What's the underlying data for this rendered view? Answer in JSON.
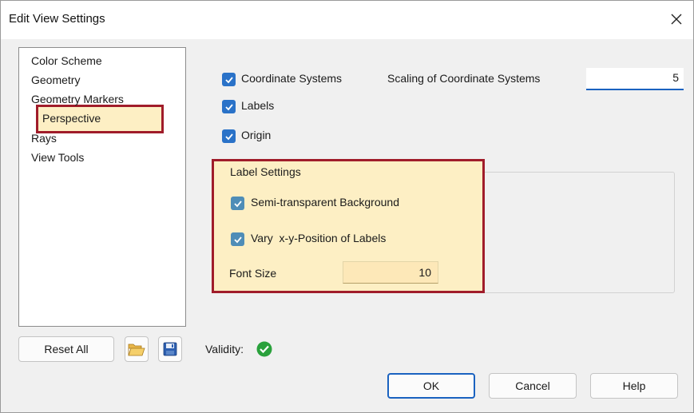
{
  "window": {
    "title": "Edit View Settings",
    "close_icon": "close-icon"
  },
  "nav": {
    "items": [
      {
        "label": "Color Scheme"
      },
      {
        "label": "Geometry"
      },
      {
        "label": "Geometry Markers"
      },
      {
        "label": "Perspective",
        "selected": true
      },
      {
        "label": "Rays"
      },
      {
        "label": "View Tools"
      }
    ]
  },
  "options": {
    "coordinate_systems": {
      "label": "Coordinate Systems",
      "checked": true
    },
    "labels": {
      "label": "Labels",
      "checked": true
    },
    "origin": {
      "label": "Origin",
      "checked": true
    },
    "scaling_label": "Scaling of Coordinate Systems",
    "scaling_value": "5"
  },
  "label_settings": {
    "title": "Label Settings",
    "semi_transparent": {
      "label": "Semi-transparent Background",
      "checked": true
    },
    "vary_position": {
      "label": "Vary  x-y-Position of Labels",
      "checked": true
    },
    "font_size_label": "Font Size",
    "font_size_value": "10"
  },
  "footer": {
    "reset_all": "Reset All",
    "open_icon": "folder-open-icon",
    "save_icon": "save-disk-icon",
    "validity_label": "Validity:",
    "validity_icon": "check-circle-icon",
    "ok": "OK",
    "cancel": "Cancel",
    "help": "Help"
  },
  "colors": {
    "accent": "#1a62c0",
    "highlight_border": "#a01c2a",
    "highlight_fill": "#fdefc4",
    "valid_green": "#2aa13c"
  }
}
